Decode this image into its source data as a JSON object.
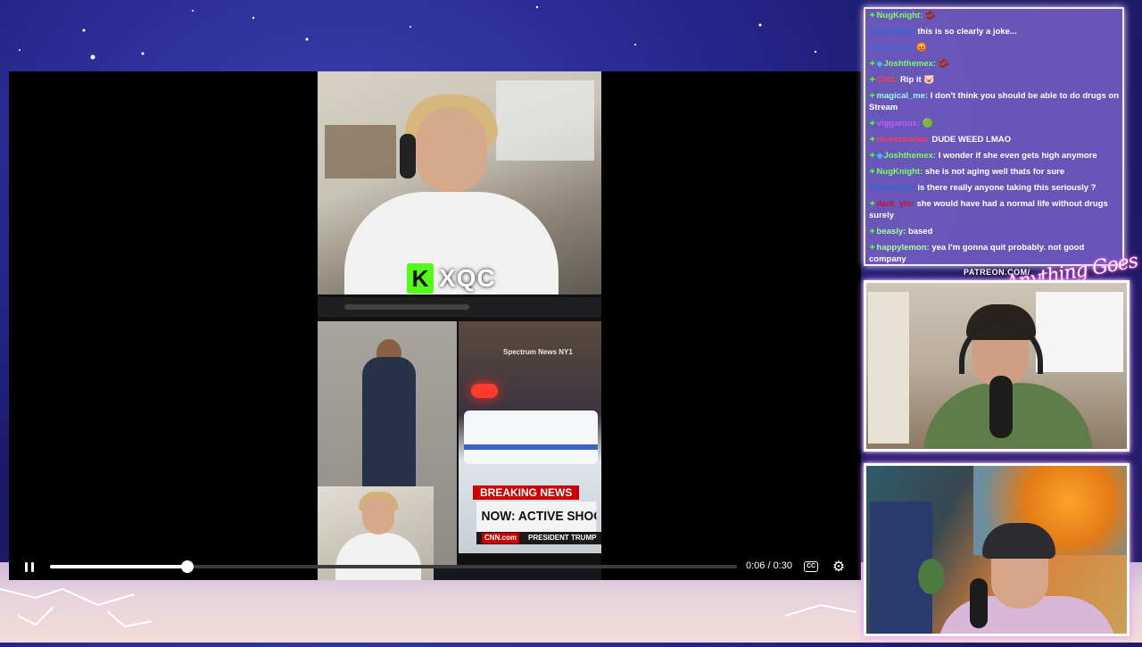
{
  "player": {
    "streamer_badge": "K",
    "streamer_name": "XQC",
    "breaking_label": "BREAKING NEWS",
    "headline": "NOW: ACTIVE SHOOTER WIT",
    "network": "CNN.com",
    "lower_third": "PRESIDENT TRUMP",
    "scene_sign": "Spectrum News NY1",
    "time_display": "0:06 / 0:30",
    "progress": 0.2
  },
  "icons": {
    "pause": "pause-icon",
    "captions": "closed-captions-icon",
    "settings": "gear-icon"
  },
  "chat": {
    "messages": [
      {
        "user": "NugKnight:",
        "color": "#7dfc6b",
        "badge": "✦",
        "text": "",
        "emote": "🫘"
      },
      {
        "user": "Firebomb4:",
        "color": "#2f6ad8",
        "badge": "",
        "text": "this is so clearly a joke...",
        "emote": ""
      },
      {
        "user": "milkytoast:",
        "color": "#4166d5",
        "badge": "",
        "text": "",
        "emote": "😡"
      },
      {
        "user": "Joshthemex:",
        "color": "#7dfc6b",
        "badge": "✦",
        "badge2": "◆",
        "text": "",
        "emote": "🫘"
      },
      {
        "user": "Cid1:",
        "color": "#ff4040",
        "badge": "✦",
        "text": "Rip it",
        "emote": "🐷"
      },
      {
        "user": "magical_me:",
        "color": "#9ef7ff",
        "badge": "✦",
        "text": "I don't think you should be able to do drugs on Stream",
        "emote": ""
      },
      {
        "user": "viggarous:",
        "color": "#c05cff",
        "badge": "✦",
        "text": "",
        "emote": "🟢"
      },
      {
        "user": "nickstarman:",
        "color": "#ff3d5a",
        "badge": "✦",
        "text": "DUDE WEED LMAO",
        "emote": ""
      },
      {
        "user": "Joshthemex:",
        "color": "#7dfc6b",
        "badge": "✦",
        "badge2": "◆",
        "text": "I wonder if she even gets high anymore",
        "emote": ""
      },
      {
        "user": "NugKnight:",
        "color": "#7dfc6b",
        "badge": "✦",
        "text": "she is not aging well thats for sure",
        "emote": ""
      },
      {
        "user": "Firebomb4:",
        "color": "#2f6ad8",
        "badge": "",
        "text": "is there really anyone taking this seriously ?",
        "emote": ""
      },
      {
        "user": "dark_yte:",
        "color": "#d0102c",
        "badge": "✦",
        "text": "she would have had a normal life without drugs surely",
        "emote": ""
      },
      {
        "user": "beasly:",
        "color": "#a6ff9c",
        "badge": "✦",
        "text": "based",
        "emote": ""
      },
      {
        "user": "happylemon:",
        "color": "#a6ff9c",
        "badge": "✦",
        "text": "yea I'm gonna quit probably. not good company",
        "emote": ""
      }
    ]
  },
  "overlay": {
    "patreon": "PATREON.COM/",
    "signature": "Anything Goes"
  }
}
